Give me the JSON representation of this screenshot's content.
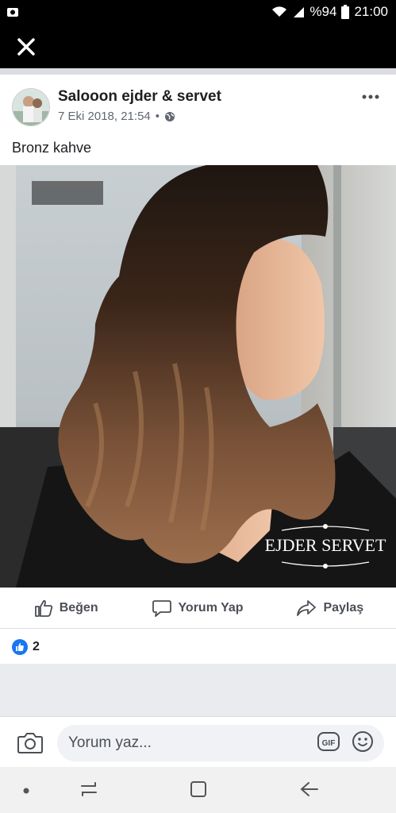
{
  "status_bar": {
    "battery_text": "%94",
    "time": "21:00"
  },
  "post": {
    "author": "Salooon ejder & servet",
    "timestamp": "7 Eki 2018, 21:54",
    "separator": "•",
    "caption": "Bronz kahve",
    "photo_logo_lines": [
      "EJDER SERVET"
    ]
  },
  "actions": {
    "like_label": "Beğen",
    "comment_label": "Yorum Yap",
    "share_label": "Paylaş"
  },
  "reactions": {
    "count": "2"
  },
  "comment_bar": {
    "placeholder": "Yorum yaz..."
  },
  "icons": {
    "status_left": "photo-notification-icon",
    "close": "close-icon",
    "more": "more-options-icon",
    "globe": "globe-icon",
    "like": "thumbs-up-icon",
    "comment": "speech-bubble-icon",
    "share": "share-arrow-icon",
    "camera": "camera-icon",
    "gif": "gif-icon",
    "emoji": "smiley-icon"
  },
  "colors": {
    "accent": "#1877f2",
    "status_bg": "#000000"
  }
}
